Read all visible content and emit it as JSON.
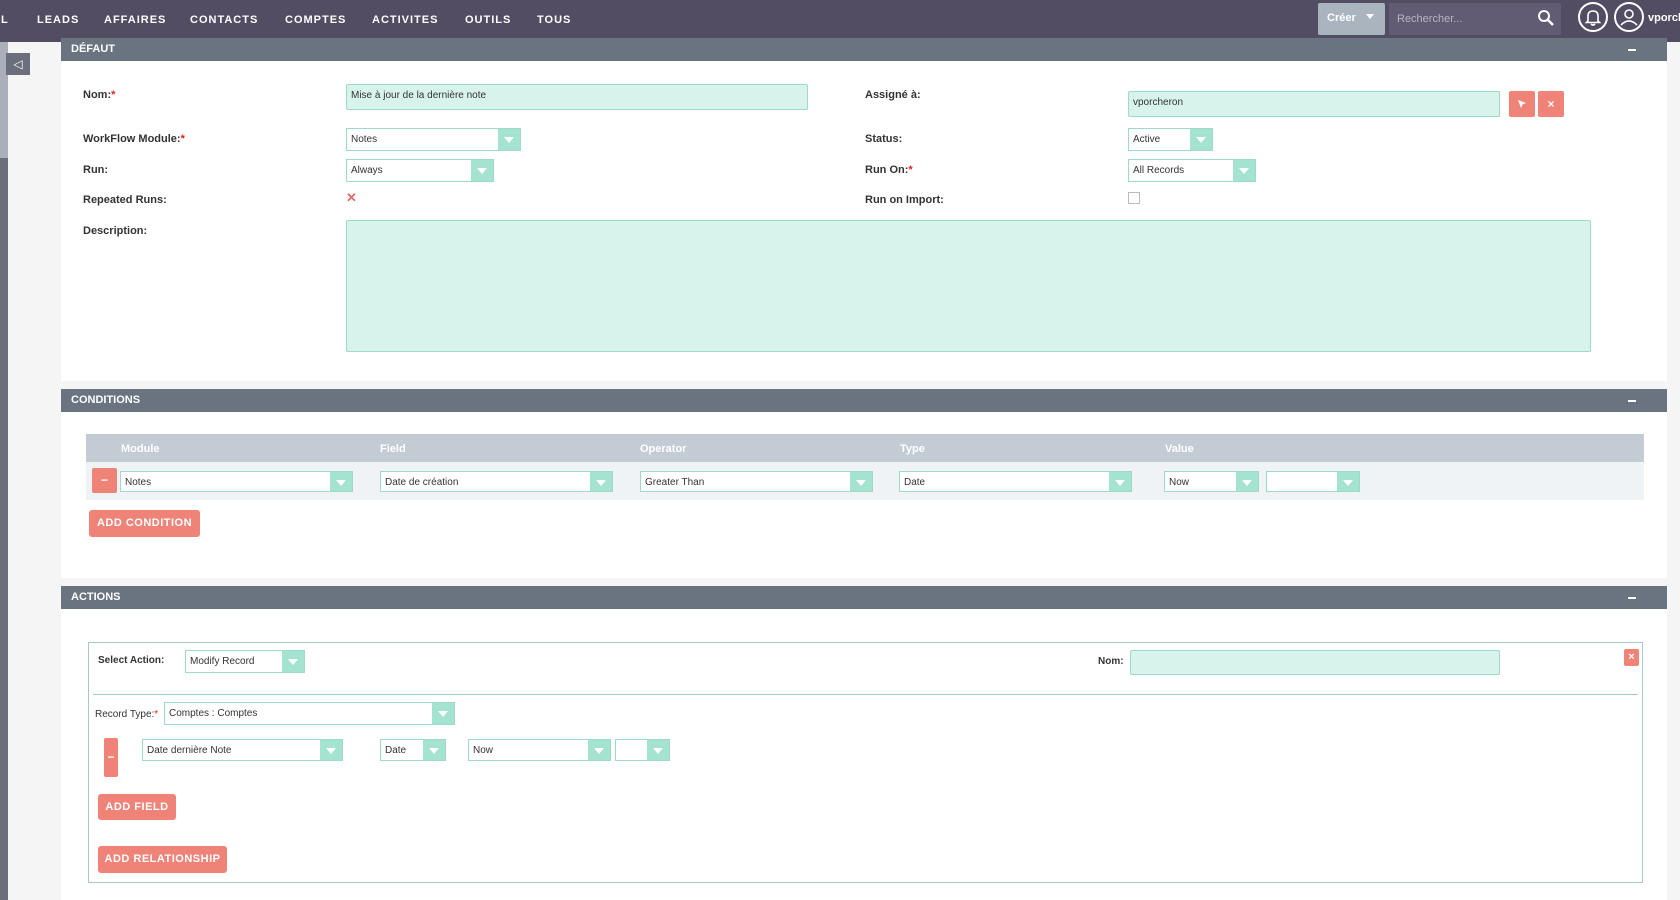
{
  "nav": {
    "items": [
      "IL",
      "LEADS",
      "AFFAIRES",
      "CONTACTS",
      "COMPTES",
      "ACTIVITES",
      "OUTILS",
      "TOUS"
    ],
    "create_label": "Créer",
    "search_placeholder": "Rechercher...",
    "username": "vporch"
  },
  "defaut": {
    "title": "DÉFAUT",
    "name_label": "Nom:",
    "name_value": "Mise à jour de la dernière note",
    "assigned_label": "Assigné à:",
    "assigned_value": "vporcheron",
    "module_label": "WorkFlow Module:",
    "module_value": "Notes",
    "status_label": "Status:",
    "status_value": "Active",
    "run_label": "Run:",
    "run_value": "Always",
    "runon_label": "Run On:",
    "runon_value": "All Records",
    "repeated_label": "Repeated Runs:",
    "repeated_checked": true,
    "import_label": "Run on Import:",
    "import_checked": false,
    "description_label": "Description:",
    "description_value": ""
  },
  "conditions": {
    "title": "CONDITIONS",
    "columns": [
      "Module",
      "Field",
      "Operator",
      "Type",
      "Value"
    ],
    "row": {
      "module": "Notes",
      "field": "Date de création",
      "operator": "Greater Than",
      "type": "Date",
      "value": "Now",
      "value2": ""
    },
    "add_label": "ADD CONDITION"
  },
  "actions": {
    "title": "ACTIONS",
    "select_action_label": "Select Action:",
    "select_action_value": "Modify Record",
    "name_label": "Nom:",
    "name_value": "",
    "record_type_label": "Record Type:",
    "record_type_value": "Comptes : Comptes",
    "field_row": {
      "field": "Date dernière Note",
      "type": "Date",
      "value": "Now",
      "value2": ""
    },
    "add_field_label": "ADD FIELD",
    "add_relationship_label": "ADD RELATIONSHIP"
  },
  "colors": {
    "nav_bg": "#534d64",
    "panel_header": "#6a7480",
    "field_bg": "#d8f3ec",
    "accent_red": "#f08377"
  }
}
